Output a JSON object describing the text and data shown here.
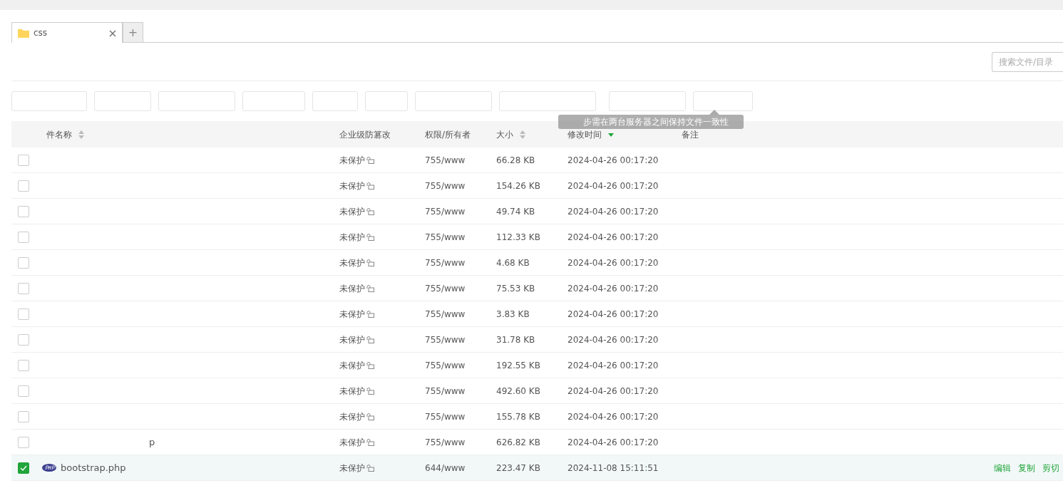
{
  "tabs": [
    {
      "label": "css",
      "kind": "folder"
    }
  ],
  "add_tab": "+",
  "search": {
    "placeholder": "搜索文件/目录"
  },
  "table": {
    "columns": [
      {
        "label": "件名称",
        "sort_active": false
      },
      {
        "label": "企业级防篡改"
      },
      {
        "label": "权限/所有者"
      },
      {
        "label": "大小",
        "sort_active": false
      },
      {
        "label": "修改时间",
        "sort_active": true
      },
      {
        "label": "备注"
      }
    ],
    "rows": [
      {
        "checked": false,
        "protect": "未保护",
        "perm": "755/www",
        "size": "66.28 KB",
        "mtime": "2024-04-26 00:17:20"
      },
      {
        "checked": false,
        "protect": "未保护",
        "perm": "755/www",
        "size": "154.26 KB",
        "mtime": "2024-04-26 00:17:20"
      },
      {
        "checked": false,
        "protect": "未保护",
        "perm": "755/www",
        "size": "49.74 KB",
        "mtime": "2024-04-26 00:17:20"
      },
      {
        "checked": false,
        "protect": "未保护",
        "perm": "755/www",
        "size": "112.33 KB",
        "mtime": "2024-04-26 00:17:20"
      },
      {
        "checked": false,
        "protect": "未保护",
        "perm": "755/www",
        "size": "4.68 KB",
        "mtime": "2024-04-26 00:17:20"
      },
      {
        "checked": false,
        "protect": "未保护",
        "perm": "755/www",
        "size": "75.53 KB",
        "mtime": "2024-04-26 00:17:20"
      },
      {
        "checked": false,
        "protect": "未保护",
        "perm": "755/www",
        "size": "3.83 KB",
        "mtime": "2024-04-26 00:17:20"
      },
      {
        "checked": false,
        "protect": "未保护",
        "perm": "755/www",
        "size": "31.78 KB",
        "mtime": "2024-04-26 00:17:20"
      },
      {
        "checked": false,
        "protect": "未保护",
        "perm": "755/www",
        "size": "192.55 KB",
        "mtime": "2024-04-26 00:17:20"
      },
      {
        "checked": false,
        "protect": "未保护",
        "perm": "755/www",
        "size": "492.60 KB",
        "mtime": "2024-04-26 00:17:20"
      },
      {
        "checked": false,
        "protect": "未保护",
        "perm": "755/www",
        "size": "155.78 KB",
        "mtime": "2024-04-26 00:17:20"
      },
      {
        "checked": false,
        "name": "p",
        "protect": "未保护",
        "perm": "755/www",
        "size": "626.82 KB",
        "mtime": "2024-04-26 00:17:20"
      },
      {
        "checked": true,
        "kind": "php",
        "name": "bootstrap.php",
        "protect": "未保护",
        "perm": "644/www",
        "size": "223.47 KB",
        "mtime": "2024-11-08 15:11:51",
        "actions": [
          "编辑",
          "复制",
          "剪切"
        ]
      }
    ]
  },
  "tooltip": "步需在两台服务器之间保持文件一致性"
}
